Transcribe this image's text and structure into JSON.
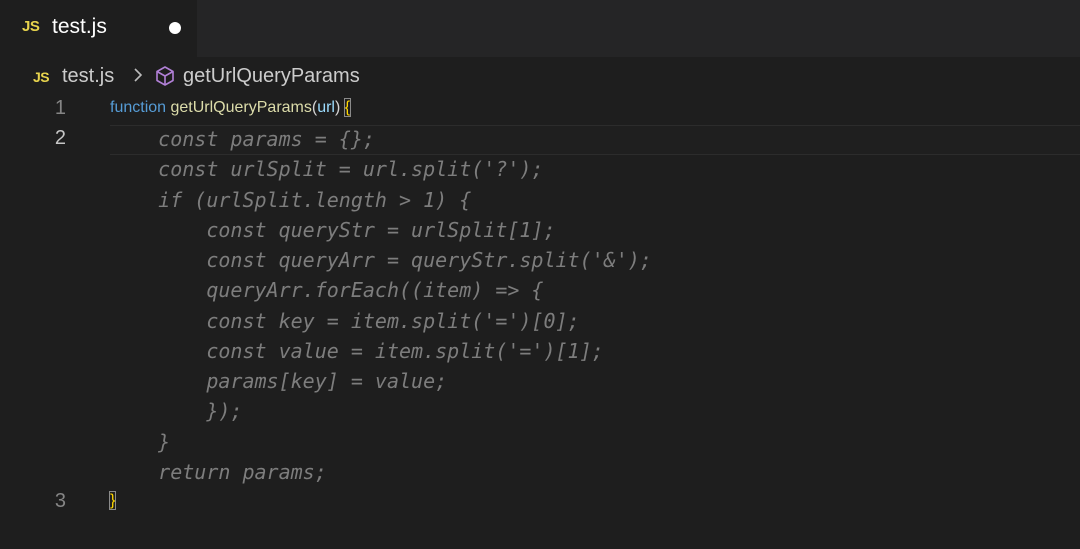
{
  "tab": {
    "badge": "JS",
    "title": "test.js"
  },
  "breadcrumb": {
    "badge": "JS",
    "file": "test.js",
    "symbol": "getUrlQueryParams"
  },
  "code": {
    "line1": {
      "number": "1",
      "keyword": "function",
      "name": "getUrlQueryParams",
      "open_paren": "(",
      "param": "url",
      "close_paren": ")",
      "brace": "{"
    },
    "line2": {
      "number": "2"
    },
    "line3": {
      "number": "3",
      "brace": "}"
    },
    "ghost_lines": [
      "    const params = {};",
      "    const urlSplit = url.split('?');",
      "    if (urlSplit.length > 1) {",
      "        const queryStr = urlSplit[1];",
      "        const queryArr = queryStr.split('&');",
      "        queryArr.forEach((item) => {",
      "        const key = item.split('=')[0];",
      "        const value = item.split('=')[1];",
      "        params[key] = value;",
      "        });",
      "    }",
      "    return params;"
    ]
  },
  "colors": {
    "background": "#1e1e1e",
    "keyword": "#569cd6",
    "function_name": "#dcdcaa",
    "parameter": "#9cdcfe",
    "ghost_text": "#7d7d7d",
    "bracket_highlight": "#ffd700",
    "js_badge": "#e8d44d"
  }
}
